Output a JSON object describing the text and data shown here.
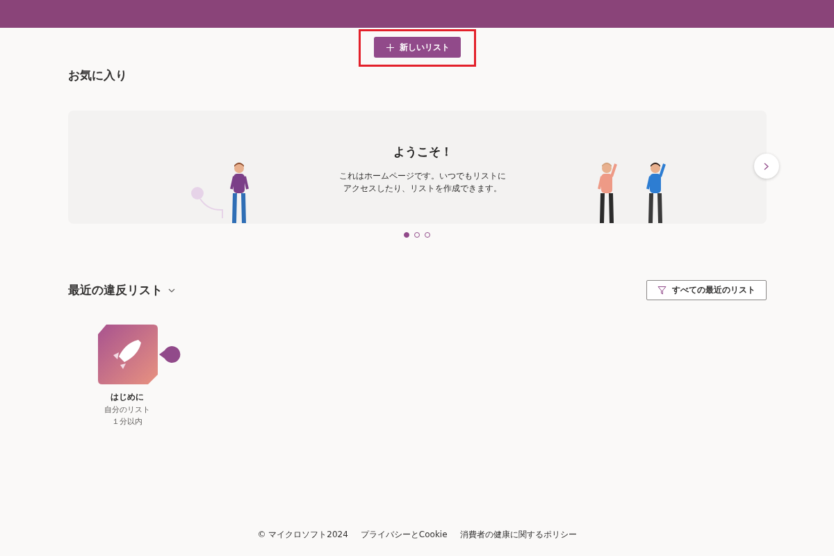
{
  "new_button": {
    "label": "新しいリスト",
    "highlighted": true
  },
  "favorites": {
    "title": "お気に入り"
  },
  "carousel": {
    "title": "ようこそ！",
    "lines": [
      "これはホームページです。いつでもリストに",
      "アクセスしたり、リストを作成できます。"
    ],
    "dots": [
      {
        "selected": true
      },
      {
        "selected": false
      },
      {
        "selected": false
      }
    ]
  },
  "recent": {
    "title": "最近の違反リスト",
    "filter_button": "すべての最近のリスト",
    "items": [
      {
        "name": "はじめに",
        "owner": "自分のリスト",
        "time": "１分以内"
      }
    ]
  },
  "footer": [
    "© マイクロソフト2024",
    "プライバシーとCookie",
    "消費者の健康に関するポリシー"
  ]
}
